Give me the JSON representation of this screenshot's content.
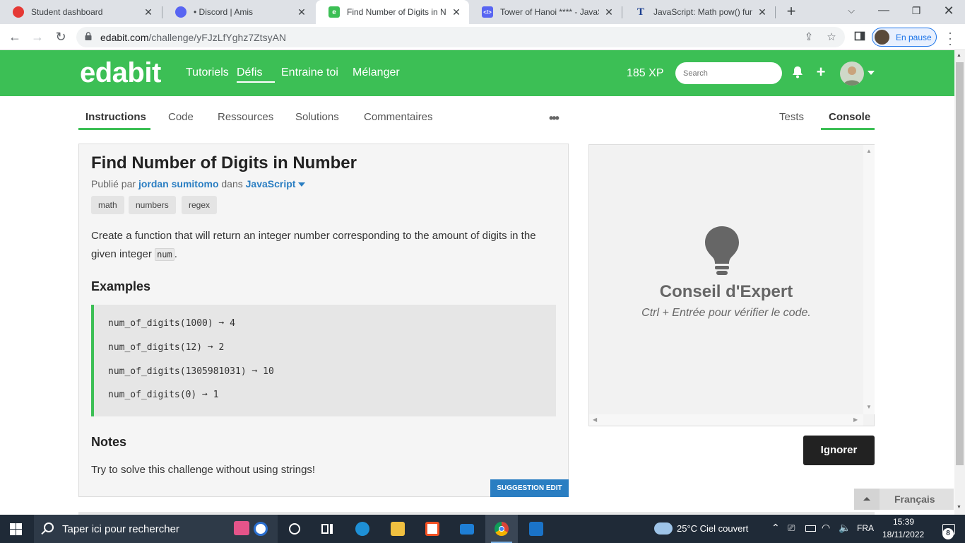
{
  "browser": {
    "tabs": [
      {
        "title": "Student dashboard",
        "icon": "student-dashboard-favicon",
        "color": "#e53935"
      },
      {
        "title": "• Discord | Amis",
        "icon": "discord-favicon",
        "color": "#5865f2"
      },
      {
        "title": "Find Number of Digits in Num",
        "icon": "edabit-favicon",
        "color": "#3cbf55"
      },
      {
        "title": "Tower of Hanoi **** - JavaScri",
        "icon": "code-favicon",
        "color": "#5865f2"
      },
      {
        "title": "JavaScript: Math pow() functio",
        "icon": "t-favicon",
        "color": "#1a3d8f"
      }
    ],
    "url_host": "edabit.com",
    "url_path": "/challenge/yFJzLfYghz7ZtsyAN",
    "profile_label": "En pause"
  },
  "header": {
    "logo": "edabit",
    "nav": [
      "Tutoriels",
      "Défis",
      "Entraine toi",
      "Mélanger"
    ],
    "active_nav": "Défis",
    "xp": "185 XP",
    "search_placeholder": "Search",
    "accent_color": "#3cbf55"
  },
  "subtabs_left": [
    "Instructions",
    "Code",
    "Ressources",
    "Solutions",
    "Commentaires"
  ],
  "subtabs_right": [
    "Tests",
    "Console"
  ],
  "challenge": {
    "title": "Find Number of Digits in Number",
    "published_prefix": "Publié par",
    "author": "jordan sumitomo",
    "in_word": "dans",
    "language": "JavaScript",
    "tags": [
      "math",
      "numbers",
      "regex"
    ],
    "description_1": "Create a function that will return an integer number corresponding to the amount of digits in the given integer ",
    "description_code": "num",
    "description_end": ".",
    "examples_heading": "Examples",
    "examples": [
      "num_of_digits(1000) ➞ 4",
      "num_of_digits(12) ➞ 2",
      "num_of_digits(1305981031) ➞ 10",
      "num_of_digits(0) ➞ 1"
    ],
    "notes_heading": "Notes",
    "notes": "Try to solve this challenge without using strings!",
    "suggest_edit": "SUGGESTION EDIT"
  },
  "console": {
    "tip_title": "Conseil d'Expert",
    "tip_text": "Ctrl + Entrée pour vérifier le code.",
    "ignore_label": "Ignorer"
  },
  "language_selector": "Français",
  "taskbar": {
    "search_text": "Taper ici pour rechercher",
    "weather": "25°C  Ciel couvert",
    "lang": "FRA",
    "time": "15:39",
    "date": "18/11/2022",
    "notifications": "8"
  }
}
